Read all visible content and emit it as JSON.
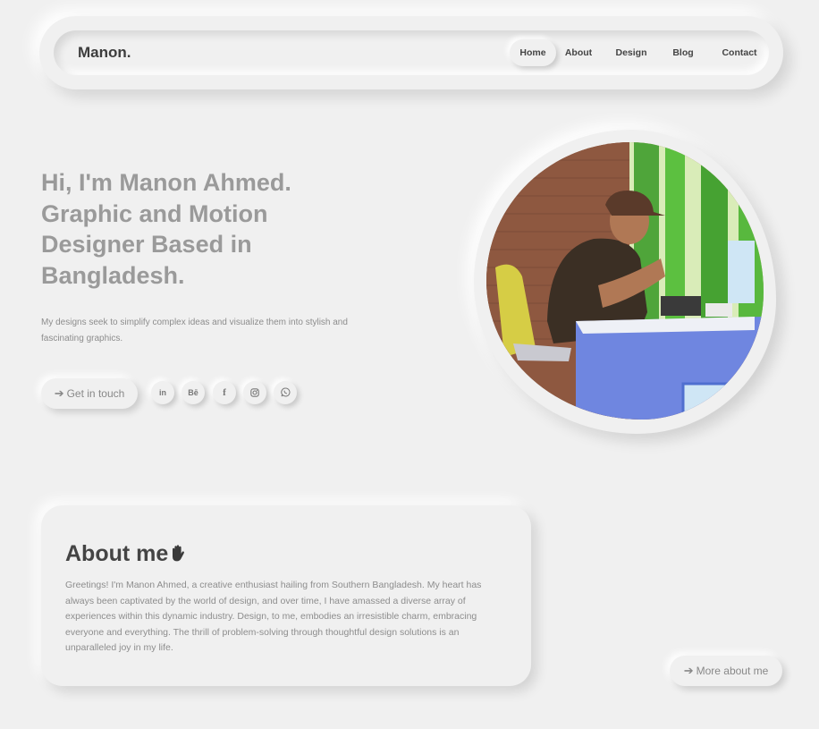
{
  "nav": {
    "brand": "Manon.",
    "links": [
      {
        "label": "Home",
        "active": true
      },
      {
        "label": "About",
        "active": false
      },
      {
        "label": "Design",
        "active": false
      },
      {
        "label": "Blog",
        "active": false
      },
      {
        "label": "Contact",
        "active": false
      }
    ]
  },
  "hero": {
    "title_lines": [
      "Hi, I'm Manon Ahmed.",
      "Graphic and Motion",
      "Designer Based in",
      "Bangladesh."
    ],
    "subtitle": "My designs seek to simplify complex ideas and visualize them into stylish and fascinating graphics.",
    "cta_label": "Get in touch",
    "cta_icon": "arrow-right-icon",
    "social": [
      {
        "name": "linkedin-icon",
        "glyph": "in"
      },
      {
        "name": "behance-icon",
        "glyph": "Bē"
      },
      {
        "name": "facebook-icon",
        "glyph": "f"
      },
      {
        "name": "instagram-icon",
        "glyph": ""
      },
      {
        "name": "whatsapp-icon",
        "glyph": ""
      }
    ],
    "photo_icon": "portrait-photo"
  },
  "about": {
    "title": "About me",
    "title_icon": "waving-hand-icon",
    "text": "Greetings! I'm Manon Ahmed, a creative enthusiast hailing from Southern Bangladesh. My heart has always been captivated by the world of design, and over time, I have amassed a diverse array of experiences within this dynamic industry. Design, to me, embodies an irresistible charm, embracing everyone and everything. The thrill of problem-solving through thoughtful design solutions is an unparalleled joy in my life.",
    "more_label": "More about me",
    "more_icon": "arrow-right-icon"
  },
  "colors": {
    "background": "#f0f0f0",
    "heading_gray": "#9a9a9a",
    "body_text": "#8d8d8d",
    "dark_text": "#444444"
  }
}
